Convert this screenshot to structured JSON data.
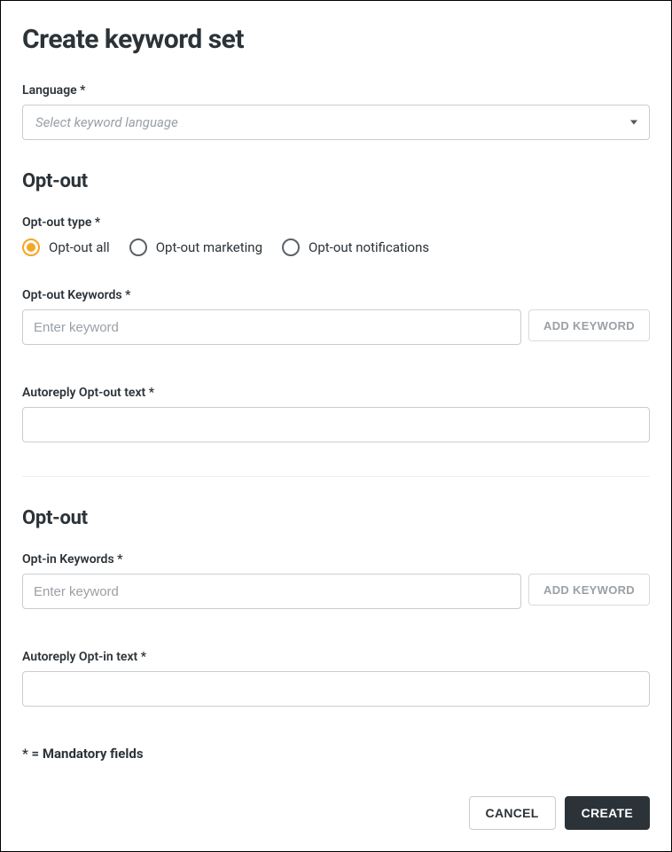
{
  "title": "Create keyword set",
  "language": {
    "label": "Language *",
    "placeholder": "Select keyword language"
  },
  "optout": {
    "heading": "Opt-out",
    "type_label": "Opt-out type *",
    "radios": [
      {
        "label": "Opt-out all",
        "checked": true
      },
      {
        "label": "Opt-out marketing",
        "checked": false
      },
      {
        "label": "Opt-out notifications",
        "checked": false
      }
    ],
    "keywords_label": "Opt-out Keywords *",
    "keyword_placeholder": "Enter keyword",
    "add_button": "ADD KEYWORD",
    "autoreply_label": "Autoreply Opt-out text *"
  },
  "optin": {
    "heading": "Opt-out",
    "keywords_label": "Opt-in Keywords *",
    "keyword_placeholder": "Enter keyword",
    "add_button": "ADD KEYWORD",
    "autoreply_label": "Autoreply Opt-in text *"
  },
  "mandatory_note": "* = Mandatory fields",
  "buttons": {
    "cancel": "CANCEL",
    "create": "CREATE"
  }
}
